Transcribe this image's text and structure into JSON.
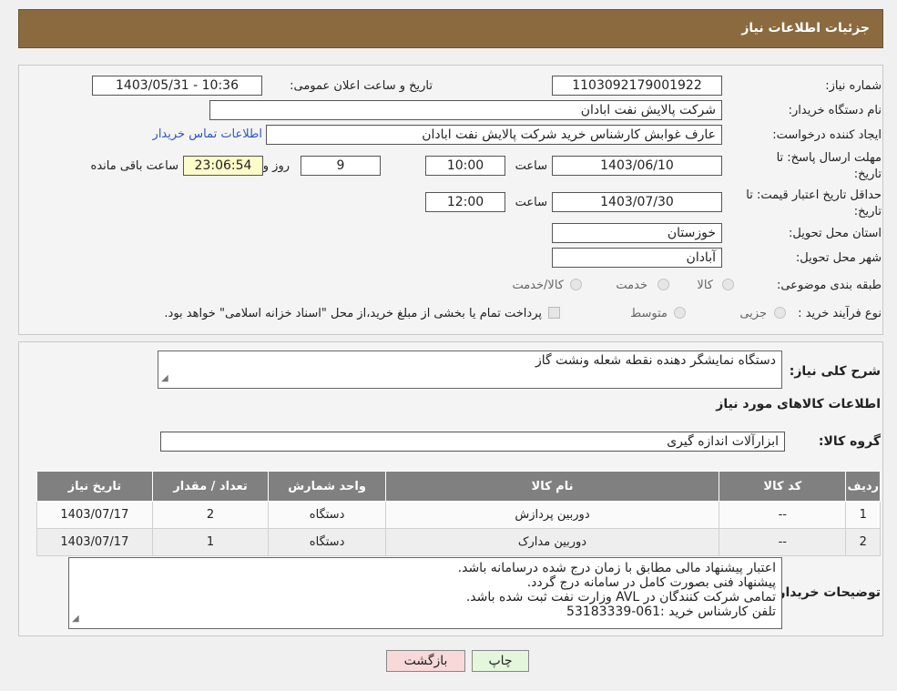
{
  "header": {
    "title": "جزئیات اطلاعات نیاز"
  },
  "info": {
    "need_number_label": "شماره نیاز:",
    "need_number": "1103092179001922",
    "announce_label": "تاریخ و ساعت اعلان عمومی:",
    "announce_value": "1403/05/31 - 10:36",
    "buyer_org_label": "نام دستگاه خریدار:",
    "buyer_org": "شرکت پالایش نفت ابادان",
    "creator_label": "ایجاد کننده درخواست:",
    "creator": "عارف غوابش کارشناس خرید شرکت پالایش نفت ابادان",
    "contact_link": "اطلاعات تماس خریدار",
    "deadline_label": "مهلت ارسال پاسخ: تا تاریخ:",
    "deadline_date": "1403/06/10",
    "time_label": "ساعت",
    "deadline_time": "10:00",
    "days_value": "9",
    "days_label": "روز و",
    "remaining_value": "23:06:54",
    "remaining_label": "ساعت باقی مانده",
    "validity_label": "حداقل تاریخ اعتبار قیمت: تا تاریخ:",
    "validity_date": "1403/07/30",
    "validity_time": "12:00",
    "province_label": "استان محل تحویل:",
    "province": "خوزستان",
    "city_label": "شهر محل تحویل:",
    "city": "آبادان",
    "category_label": "طبقه بندی موضوعی:",
    "category_options": [
      "کالا",
      "خدمت",
      "کالا/خدمت"
    ],
    "process_label": "نوع فرآیند خرید :",
    "process_options": [
      "جزیی",
      "متوسط"
    ],
    "process_note": "پرداخت تمام یا بخشی از مبلغ خرید،از محل \"اسناد خزانه اسلامی\" خواهد بود."
  },
  "details": {
    "desc_label": "شرح کلی نیاز:",
    "desc_value": "دستگاه  نمایشگر دهنده نقطه شعله ونشت گاز",
    "goods_info_title": "اطلاعات کالاهای مورد نیاز",
    "group_label": "گروه کالا:",
    "group_value": "ابزارآلات اندازه گیری",
    "table": {
      "headers": [
        "ردیف",
        "کد کالا",
        "نام کالا",
        "واحد شمارش",
        "تعداد / مقدار",
        "تاریخ نیاز"
      ],
      "rows": [
        [
          "1",
          "--",
          "دوربین پردازش",
          "دستگاه",
          "2",
          "1403/07/17"
        ],
        [
          "2",
          "--",
          "دوربین مدارک",
          "دستگاه",
          "1",
          "1403/07/17"
        ]
      ]
    },
    "notes_label": "توضیحات خریدار:",
    "notes_lines": [
      "اعتبار پیشنهاد مالی مطابق با زمان درج شده درسامانه باشد.",
      "پیشنهاد فنی بصورت کامل در سامانه درج گردد.",
      "تمامی شرکت کنندگان در AVL وزارت نفت ثبت شده باشد.",
      "تلفن کارشناس خرید :061-53183339"
    ]
  },
  "buttons": {
    "back": "بازگشت",
    "print": "چاپ"
  },
  "colors": {
    "header_bg": "#8b6a3f",
    "table_header_bg": "#808080",
    "back_btn_bg": "#f8d8d8",
    "print_btn_bg": "#e4f6dc",
    "remaining_bg": "#fcfcc8"
  }
}
